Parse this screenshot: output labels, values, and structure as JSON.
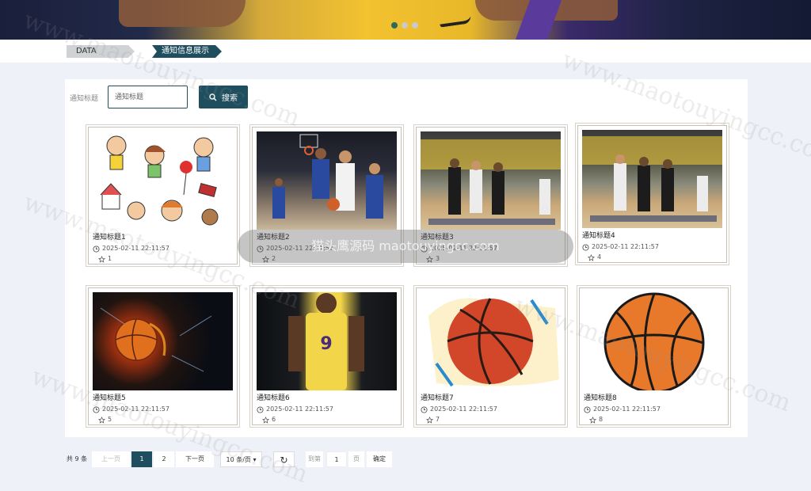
{
  "banner": {
    "slides": 3,
    "active_slide": 1
  },
  "breadcrumb": {
    "items": [
      "DATA SHOW",
      "通知信息展示"
    ]
  },
  "search": {
    "label": "通知标题",
    "placeholder": "通知标题",
    "button_label": "搜索",
    "button_icon": "search-icon"
  },
  "cards": [
    {
      "title": "通知标题1",
      "time": "2025-02-11 22:11:57",
      "likes": "1",
      "image": "cartoon-kids"
    },
    {
      "title": "通知标题2",
      "time": "2025-02-11 22:11:57",
      "likes": "2",
      "image": "basketball-game"
    },
    {
      "title": "通知标题3",
      "time": "2025-02-11 22:11:57",
      "likes": "3",
      "image": "basketball-court"
    },
    {
      "title": "通知标题4",
      "time": "2025-02-11 22:11:57",
      "likes": "4",
      "image": "basketball-court"
    },
    {
      "title": "通知标题5",
      "time": "2025-02-11 22:11:57",
      "likes": "5",
      "image": "fire-basketball"
    },
    {
      "title": "通知标题6",
      "time": "2025-02-11 22:11:57",
      "likes": "6",
      "image": "lakers-player"
    },
    {
      "title": "通知标题7",
      "time": "2025-02-11 22:11:57",
      "likes": "7",
      "image": "painted-basketball"
    },
    {
      "title": "通知标题8",
      "time": "2025-02-11 22:11:57",
      "likes": "8",
      "image": "cartoon-basketball"
    }
  ],
  "pagination": {
    "total": "共 9 条",
    "prev": "上一页",
    "pages": [
      "1",
      "2"
    ],
    "current": "1",
    "next": "下一页",
    "page_size": "10 条/页",
    "goto_label": "到第",
    "goto_value": "1",
    "goto_unit": "页",
    "confirm": "确定"
  },
  "colors": {
    "accent": "#1f4e5f",
    "page_bg": "#eef2f8"
  },
  "watermark": {
    "center_text": "猫头鹰源码 maotouyingcc.com",
    "repeat_text": "www.maotouyingcc.com"
  }
}
